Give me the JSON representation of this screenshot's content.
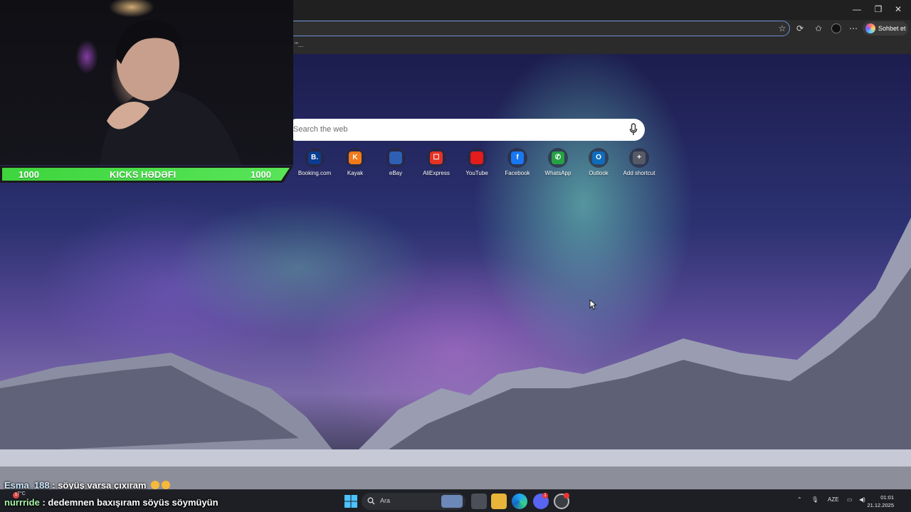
{
  "browser": {
    "copilot_label": "Sohbet et",
    "window_controls": {
      "minimize": "—",
      "maximize": "❐",
      "close": "✕"
    },
    "favorites_overflow": "'\"..."
  },
  "new_tab": {
    "search_placeholder": "Search the web",
    "shortcuts": [
      {
        "label": "Booking.com",
        "glyph": "B.",
        "color": "#0a3d8f",
        "icon": "booking-icon"
      },
      {
        "label": "Kayak",
        "glyph": "K",
        "color": "#f27a1a",
        "icon": "kayak-icon"
      },
      {
        "label": "eBay",
        "glyph": "",
        "color": "#2f5fb3",
        "icon": "ebay-icon"
      },
      {
        "label": "AliExpress",
        "glyph": "☐",
        "color": "#e43225",
        "icon": "aliexpress-icon"
      },
      {
        "label": "YouTube",
        "glyph": "",
        "color": "#e21b1b",
        "icon": "youtube-icon"
      },
      {
        "label": "Facebook",
        "glyph": "f",
        "color": "#1877f2",
        "icon": "facebook-icon"
      },
      {
        "label": "WhatsApp",
        "glyph": "✆",
        "color": "#25a244",
        "icon": "whatsapp-icon"
      },
      {
        "label": "Outlook",
        "glyph": "O",
        "color": "#0f6cbd",
        "icon": "outlook-icon"
      },
      {
        "label": "Add shortcut",
        "glyph": "+",
        "color": "#555a66",
        "icon": "add-icon"
      }
    ]
  },
  "stream_overlay": {
    "kicks_goal": {
      "current": "1000",
      "title": "KICKS HƏDƏFI",
      "target": "1000",
      "progress": 1.0
    },
    "chat": [
      {
        "user": "Esma_188",
        "message": "söyüş varsa çıxıram"
      },
      {
        "user": "nurrride",
        "message": "dedemnen baxışıram söyüs söymüyün"
      }
    ]
  },
  "taskbar": {
    "weather_temp": "7°C",
    "weather_badge": "1",
    "search_label": "Ara",
    "discord_badge": "1",
    "language": "AZE",
    "time": "01:01",
    "date": "21.12.2025"
  }
}
